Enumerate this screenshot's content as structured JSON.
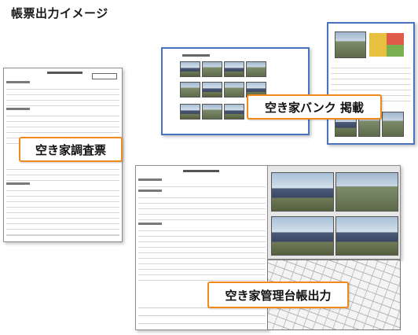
{
  "header": {
    "title": "帳票出力イメージ"
  },
  "callouts": {
    "survey_sheet": "空き家調査票",
    "bank_listing": "空き家バンク 掲載",
    "ledger_output": "空き家管理台帳出力"
  },
  "colors": {
    "callout_border": "#f08a1a",
    "window_border": "#4a73c2"
  }
}
